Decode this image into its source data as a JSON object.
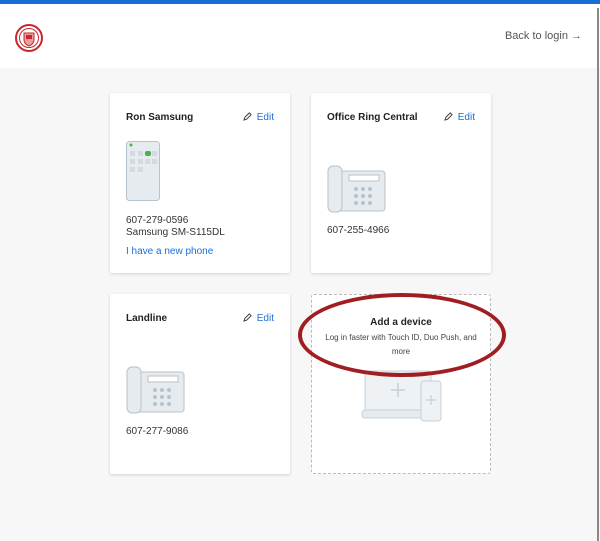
{
  "header": {
    "back_label": "Back to login",
    "back_icon": "arrow-right-icon"
  },
  "devices": [
    {
      "name": "Ron Samsung",
      "edit_label": "Edit",
      "phone": "607-279-0596",
      "model": "Samsung SM-S115DL",
      "link": "I have a new phone",
      "icon": "smartphone-icon"
    },
    {
      "name": "Office Ring Central",
      "edit_label": "Edit",
      "phone": "607-255-4966",
      "icon": "desk-phone-icon"
    },
    {
      "name": "Landline",
      "edit_label": "Edit",
      "phone": "607-277-9086",
      "icon": "desk-phone-icon"
    }
  ],
  "add_device": {
    "title": "Add a device",
    "subtitle": "Log in faster with Touch ID, Duo Push, and more"
  },
  "colors": {
    "accent": "#1a6fd6",
    "annotation": "#a01e22",
    "logo": "#c8282d"
  }
}
